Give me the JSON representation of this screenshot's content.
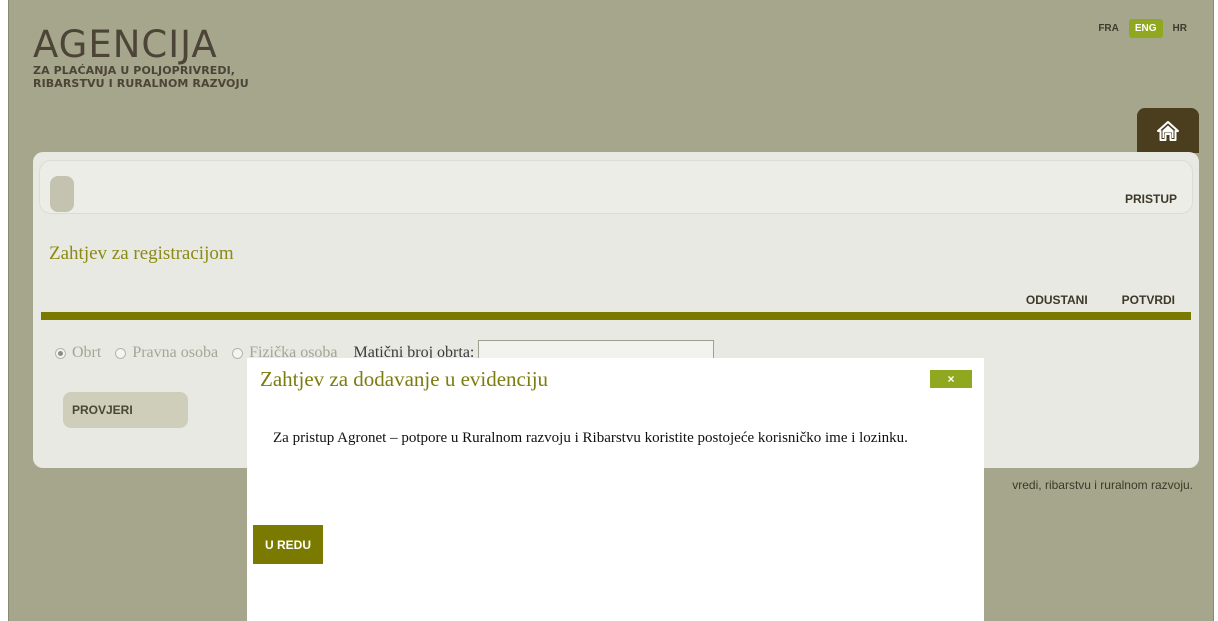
{
  "header": {
    "logo_title": "AGENCIJA",
    "logo_line1": "ZA PLAĆANJA U POLJOPRIVREDI,",
    "logo_line2": "RIBARSTVU I RURALNOM RAZVOJU",
    "languages": [
      {
        "label": "FRA",
        "active": false
      },
      {
        "label": "ENG",
        "active": true
      },
      {
        "label": "HR",
        "active": false
      }
    ],
    "home_icon": "home-icon"
  },
  "nav": {
    "pristup": "PRISTUP"
  },
  "page": {
    "heading": "Zahtjev za registracijom",
    "odustani": "ODUSTANI",
    "potvrdi": "POTVRDI",
    "radio_options": [
      {
        "label": "Obrt",
        "checked": true
      },
      {
        "label": "Pravna osoba",
        "checked": false
      },
      {
        "label": "Fizička osoba",
        "checked": false
      }
    ],
    "maticni_label": "Matični broj obrta:",
    "maticni_value": "",
    "provjeri": "PROVJERI"
  },
  "footer": {
    "text": "vredi, ribarstvu i ruralnom razvoju."
  },
  "modal": {
    "title": "Zahtjev za dodavanje u evidenciju",
    "close": "×",
    "body": "Za pristup Agronet – potpore u Ruralnom razvoju i Ribarstvu koristite postojeće korisničko ime i lozinku.",
    "ok": "U REDU"
  },
  "colors": {
    "background": "#a6a68c",
    "accent": "#8fa820",
    "olive": "#7a7a00",
    "brown": "#4a3e1f"
  }
}
